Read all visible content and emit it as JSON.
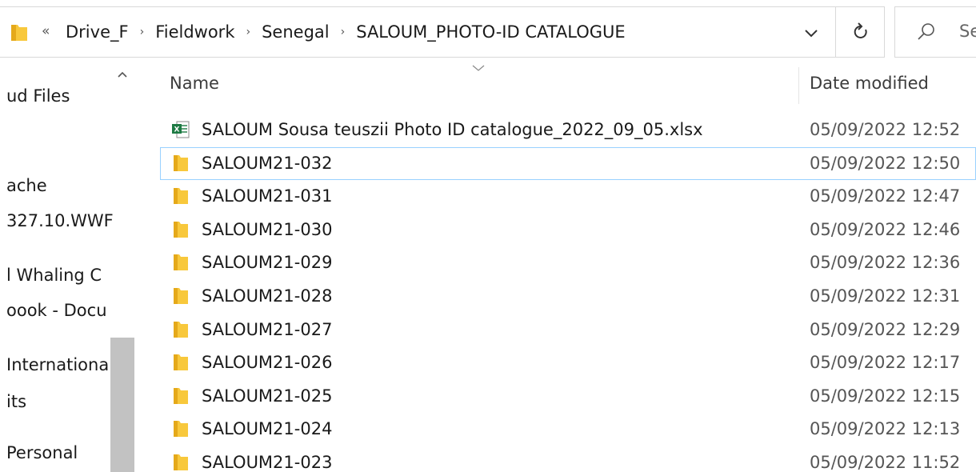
{
  "address_bar": {
    "overflow_label": "«",
    "breadcrumbs": [
      "Drive_F",
      "Fieldwork",
      "Senegal",
      "SALOUM_PHOTO-ID CATALOGUE"
    ],
    "separator": "›"
  },
  "search": {
    "placeholder": "Se"
  },
  "sidebar": {
    "items": [
      {
        "label": "ud Files"
      },
      {
        "label": "ache"
      },
      {
        "label": "327.10.WWF"
      },
      {
        "label": "l Whaling C"
      },
      {
        "label": "oook - Docu"
      },
      {
        "label": "Internationa"
      },
      {
        "label": "its"
      },
      {
        "label": "Personal"
      }
    ]
  },
  "columns": {
    "name": "Name",
    "date_modified": "Date modified"
  },
  "files": [
    {
      "name": "SALOUM Sousa teuszii Photo ID catalogue_2022_09_05.xlsx",
      "date": "05/09/2022 12:52",
      "type": "excel",
      "selected": false
    },
    {
      "name": "SALOUM21-032",
      "date": "05/09/2022 12:50",
      "type": "folder",
      "selected": true
    },
    {
      "name": "SALOUM21-031",
      "date": "05/09/2022 12:47",
      "type": "folder",
      "selected": false
    },
    {
      "name": "SALOUM21-030",
      "date": "05/09/2022 12:46",
      "type": "folder",
      "selected": false
    },
    {
      "name": "SALOUM21-029",
      "date": "05/09/2022 12:36",
      "type": "folder",
      "selected": false
    },
    {
      "name": "SALOUM21-028",
      "date": "05/09/2022 12:31",
      "type": "folder",
      "selected": false
    },
    {
      "name": "SALOUM21-027",
      "date": "05/09/2022 12:29",
      "type": "folder",
      "selected": false
    },
    {
      "name": "SALOUM21-026",
      "date": "05/09/2022 12:17",
      "type": "folder",
      "selected": false
    },
    {
      "name": "SALOUM21-025",
      "date": "05/09/2022 12:15",
      "type": "folder",
      "selected": false
    },
    {
      "name": "SALOUM21-024",
      "date": "05/09/2022 12:13",
      "type": "folder",
      "selected": false
    },
    {
      "name": "SALOUM21-023",
      "date": "05/09/2022 11:52",
      "type": "folder",
      "selected": false
    }
  ],
  "colors": {
    "folder": "#f8c83c",
    "folder_shade": "#e5a91a",
    "excel_green": "#1d7a43",
    "selection_border": "#99d1ff",
    "scroll_thumb": "#c2c2c2"
  }
}
